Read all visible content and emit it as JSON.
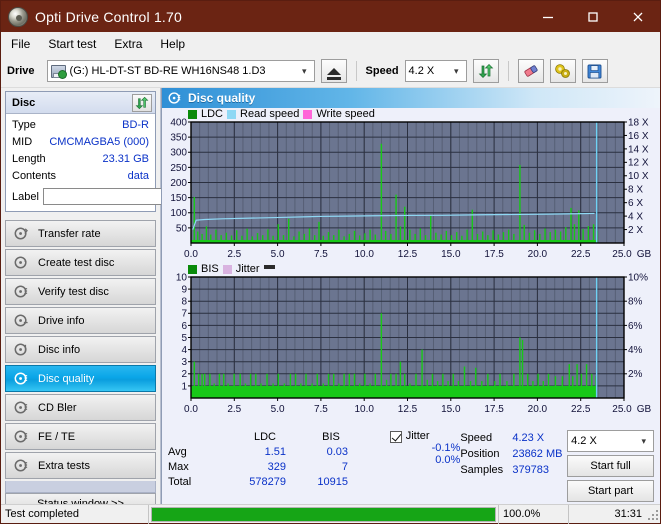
{
  "window": {
    "title": "Opti Drive Control 1.70",
    "icon": "disc-icon",
    "minimize": "—",
    "maximize": "□",
    "close": "×"
  },
  "menu": {
    "items": [
      "File",
      "Start test",
      "Extra",
      "Help"
    ]
  },
  "toolbar": {
    "drive_label": "Drive",
    "drive_value": "(G:)  HL-DT-ST BD-RE  WH16NS48 1.D3",
    "eject_title": "Eject",
    "speed_label": "Speed",
    "speed_value": "4.2 X",
    "refresh_title": "Refresh",
    "erase_title": "Erase",
    "tools_title": "Tools",
    "save_title": "Save"
  },
  "disc_panel": {
    "title": "Disc",
    "rows": [
      {
        "key": "Type",
        "value": "BD-R"
      },
      {
        "key": "MID",
        "value": "CMCMAGBA5 (000)"
      },
      {
        "key": "Length",
        "value": "23.31 GB"
      },
      {
        "key": "Contents",
        "value": "data"
      }
    ],
    "label_key": "Label",
    "label_value": "",
    "label_placeholder": ""
  },
  "sidebar": {
    "items": [
      {
        "label": "Transfer rate",
        "active": false
      },
      {
        "label": "Create test disc",
        "active": false
      },
      {
        "label": "Verify test disc",
        "active": false
      },
      {
        "label": "Drive info",
        "active": false
      },
      {
        "label": "Disc info",
        "active": false
      },
      {
        "label": "Disc quality",
        "active": true
      },
      {
        "label": "CD Bler",
        "active": false
      },
      {
        "label": "FE / TE",
        "active": false
      },
      {
        "label": "Extra tests",
        "active": false
      }
    ],
    "status_window": "Status window >>"
  },
  "main": {
    "title": "Disc quality"
  },
  "stats": {
    "col_headers": [
      "LDC",
      "BIS"
    ],
    "rows": [
      {
        "key": "Avg",
        "ldc": "1.51",
        "bis": "0.03"
      },
      {
        "key": "Max",
        "ldc": "329",
        "bis": "7"
      },
      {
        "key": "Total",
        "ldc": "578279",
        "bis": "10915"
      }
    ],
    "jitter_label": "Jitter",
    "jitter_checked": true,
    "jitter_values": [
      "-0.1%",
      "0.0%"
    ],
    "speed_key": "Speed",
    "speed_value": "4.23 X",
    "position_key": "Position",
    "position_value": "23862 MB",
    "samples_key": "Samples",
    "samples_value": "379783",
    "speed_select": "4.2 X",
    "start_full": "Start full",
    "start_part": "Start part"
  },
  "statusbar": {
    "message": "Test completed",
    "progress_percent": "100.0%",
    "progress_value": 100,
    "elapsed": "31:31"
  },
  "colors": {
    "title_bar": "#6b2413",
    "plot_bg": "#6b7590",
    "ldc_green": "#18c818",
    "read_speed": "#8fd8f4",
    "write_speed": "#ff66d8",
    "jitter": "#d9b3e0",
    "accent_blue": "#0a32c8",
    "progress_green": "#16a516"
  },
  "chart_data": [
    {
      "type": "line",
      "id": "disc-quality-ldc",
      "title": "",
      "xlabel": "GB",
      "ylabel": "LDC",
      "xlim": [
        0,
        25.0
      ],
      "xticks": [
        "0.0",
        "2.5",
        "5.0",
        "7.5",
        "10.0",
        "12.5",
        "15.0",
        "17.5",
        "20.0",
        "22.5",
        "25.0"
      ],
      "x_unit": "GB",
      "ylim": [
        0,
        400
      ],
      "yticks": [
        "50",
        "100",
        "150",
        "200",
        "250",
        "300",
        "350",
        "400"
      ],
      "y2label": "Speed",
      "y2lim": [
        0,
        18
      ],
      "y2ticks": [
        "2 X",
        "4 X",
        "6 X",
        "8 X",
        "10 X",
        "12 X",
        "14 X",
        "16 X",
        "18 X"
      ],
      "grid": true,
      "legend": [
        "LDC",
        "Read speed",
        "Write speed"
      ],
      "legend_position": "top-left",
      "series": [
        {
          "name": "LDC",
          "kind": "bars",
          "color": "#18c818",
          "baseline": 10,
          "points": [
            [
              0.15,
              152
            ],
            [
              0.35,
              38
            ],
            [
              0.6,
              30
            ],
            [
              0.85,
              55
            ],
            [
              1.1,
              28
            ],
            [
              1.4,
              44
            ],
            [
              1.7,
              26
            ],
            [
              2.0,
              34
            ],
            [
              2.3,
              25
            ],
            [
              2.6,
              42
            ],
            [
              2.9,
              24
            ],
            [
              3.2,
              47
            ],
            [
              3.5,
              22
            ],
            [
              3.8,
              33
            ],
            [
              4.1,
              26
            ],
            [
              4.4,
              45
            ],
            [
              4.7,
              24
            ],
            [
              5.0,
              62
            ],
            [
              5.3,
              26
            ],
            [
              5.6,
              80
            ],
            [
              5.9,
              22
            ],
            [
              6.2,
              38
            ],
            [
              6.5,
              30
            ],
            [
              6.8,
              48
            ],
            [
              7.1,
              26
            ],
            [
              7.35,
              70
            ],
            [
              7.6,
              24
            ],
            [
              7.9,
              36
            ],
            [
              8.2,
              26
            ],
            [
              8.5,
              44
            ],
            [
              8.8,
              22
            ],
            [
              9.1,
              30
            ],
            [
              9.4,
              40
            ],
            [
              9.7,
              25
            ],
            [
              10.0,
              32
            ],
            [
              10.3,
              44
            ],
            [
              10.6,
              28
            ],
            [
              10.95,
              328
            ],
            [
              11.2,
              40
            ],
            [
              11.5,
              30
            ],
            [
              11.8,
              160
            ],
            [
              12.05,
              55
            ],
            [
              12.3,
              120
            ],
            [
              12.6,
              44
            ],
            [
              12.9,
              30
            ],
            [
              13.2,
              48
            ],
            [
              13.5,
              26
            ],
            [
              13.8,
              92
            ],
            [
              14.1,
              34
            ],
            [
              14.4,
              28
            ],
            [
              14.7,
              40
            ],
            [
              15.0,
              26
            ],
            [
              15.3,
              36
            ],
            [
              15.6,
              24
            ],
            [
              15.9,
              44
            ],
            [
              16.2,
              110
            ],
            [
              16.5,
              30
            ],
            [
              16.8,
              38
            ],
            [
              17.1,
              26
            ],
            [
              17.4,
              42
            ],
            [
              17.7,
              28
            ],
            [
              18.0,
              36
            ],
            [
              18.3,
              44
            ],
            [
              18.6,
              30
            ],
            [
              18.95,
              258
            ],
            [
              19.2,
              60
            ],
            [
              19.5,
              34
            ],
            [
              19.8,
              42
            ],
            [
              20.1,
              30
            ],
            [
              20.4,
              48
            ],
            [
              20.7,
              36
            ],
            [
              21.0,
              44
            ],
            [
              21.3,
              38
            ],
            [
              21.6,
              52
            ],
            [
              21.9,
              116
            ],
            [
              22.1,
              62
            ],
            [
              22.35,
              108
            ],
            [
              22.6,
              46
            ],
            [
              22.9,
              56
            ],
            [
              23.2,
              62
            ],
            [
              23.4,
              40
            ]
          ]
        },
        {
          "name": "Read speed",
          "kind": "line",
          "color": "#8fd8f4",
          "axis": "right",
          "points": [
            [
              0.1,
              2.0
            ],
            [
              0.3,
              3.4
            ],
            [
              0.8,
              3.5
            ],
            [
              1.8,
              3.6
            ],
            [
              3.4,
              3.7
            ],
            [
              5.2,
              3.8
            ],
            [
              6.7,
              3.9
            ],
            [
              7.4,
              3.95
            ],
            [
              9.0,
              4.0
            ],
            [
              10.6,
              4.05
            ],
            [
              12.4,
              4.1
            ],
            [
              14.6,
              4.12
            ],
            [
              16.8,
              4.2
            ],
            [
              19.0,
              4.25
            ],
            [
              20.6,
              4.3
            ],
            [
              22.2,
              4.35
            ],
            [
              23.3,
              4.4
            ]
          ]
        },
        {
          "name": "marker",
          "kind": "vline",
          "color": "#6fd2f5",
          "x": 23.42
        }
      ]
    },
    {
      "type": "line",
      "id": "disc-quality-bis",
      "title": "",
      "xlabel": "GB",
      "ylabel": "BIS",
      "xlim": [
        0,
        25.0
      ],
      "xticks": [
        "0.0",
        "2.5",
        "5.0",
        "7.5",
        "10.0",
        "12.5",
        "15.0",
        "17.5",
        "20.0",
        "22.5",
        "25.0"
      ],
      "x_unit": "GB",
      "ylim": [
        0,
        10
      ],
      "yticks": [
        "1",
        "2",
        "3",
        "4",
        "5",
        "6",
        "7",
        "8",
        "9",
        "10"
      ],
      "y2label": "Jitter",
      "y2lim": [
        0,
        10
      ],
      "y2ticks": [
        "2%",
        "4%",
        "6%",
        "8%",
        "10%"
      ],
      "grid": true,
      "legend": [
        "BIS",
        "Jitter"
      ],
      "legend_position": "top-left",
      "series": [
        {
          "name": "BIS",
          "kind": "bars",
          "color": "#18c818",
          "baseline": 1.0,
          "points": [
            [
              0.15,
              3.0
            ],
            [
              0.4,
              2.0
            ],
            [
              0.6,
              2.0
            ],
            [
              0.75,
              2.0
            ],
            [
              1.05,
              2.0
            ],
            [
              1.3,
              1.2
            ],
            [
              1.6,
              2.0
            ],
            [
              1.85,
              2.0
            ],
            [
              2.1,
              1.2
            ],
            [
              2.45,
              2.0
            ],
            [
              2.8,
              2.0
            ],
            [
              3.1,
              1.2
            ],
            [
              3.4,
              2.0
            ],
            [
              3.7,
              2.0
            ],
            [
              4.0,
              1.2
            ],
            [
              4.35,
              2.0
            ],
            [
              4.7,
              1.2
            ],
            [
              5.0,
              2.0
            ],
            [
              5.35,
              1.2
            ],
            [
              5.7,
              2.0
            ],
            [
              6.0,
              2.0
            ],
            [
              6.3,
              1.2
            ],
            [
              6.6,
              2.0
            ],
            [
              6.95,
              1.2
            ],
            [
              7.25,
              2.0
            ],
            [
              7.6,
              1.2
            ],
            [
              7.9,
              2.0
            ],
            [
              8.2,
              2.0
            ],
            [
              8.5,
              1.2
            ],
            [
              8.8,
              2.0
            ],
            [
              9.1,
              2.0
            ],
            [
              9.4,
              2.0
            ],
            [
              9.7,
              1.2
            ],
            [
              10.0,
              2.0
            ],
            [
              10.3,
              1.2
            ],
            [
              10.6,
              2.0
            ],
            [
              10.95,
              7.0
            ],
            [
              11.25,
              1.5
            ],
            [
              11.5,
              2.0
            ],
            [
              11.8,
              2.0
            ],
            [
              12.05,
              3.0
            ],
            [
              12.3,
              2.0
            ],
            [
              12.6,
              1.2
            ],
            [
              12.95,
              2.0
            ],
            [
              13.3,
              4.0
            ],
            [
              13.6,
              1.5
            ],
            [
              13.9,
              2.0
            ],
            [
              14.2,
              1.4
            ],
            [
              14.5,
              2.0
            ],
            [
              14.8,
              1.4
            ],
            [
              15.1,
              2.0
            ],
            [
              15.4,
              1.4
            ],
            [
              15.75,
              2.6
            ],
            [
              16.1,
              1.4
            ],
            [
              16.4,
              2.5
            ],
            [
              16.75,
              1.4
            ],
            [
              17.1,
              2.0
            ],
            [
              17.5,
              1.4
            ],
            [
              17.8,
              2.0
            ],
            [
              18.2,
              1.4
            ],
            [
              18.6,
              2.0
            ],
            [
              18.95,
              5.0
            ],
            [
              19.1,
              4.8
            ],
            [
              19.4,
              2.0
            ],
            [
              19.7,
              1.4
            ],
            [
              20.0,
              2.0
            ],
            [
              20.3,
              1.4
            ],
            [
              20.6,
              2.0
            ],
            [
              21.0,
              1.8
            ],
            [
              21.4,
              1.8
            ],
            [
              21.8,
              2.8
            ],
            [
              22.0,
              1.8
            ],
            [
              22.25,
              2.8
            ],
            [
              22.5,
              2.0
            ],
            [
              22.8,
              2.8
            ],
            [
              23.1,
              2.0
            ],
            [
              23.35,
              1.8
            ]
          ]
        },
        {
          "name": "marker",
          "kind": "vline",
          "color": "#6fd2f5",
          "x": 23.42
        }
      ]
    }
  ]
}
